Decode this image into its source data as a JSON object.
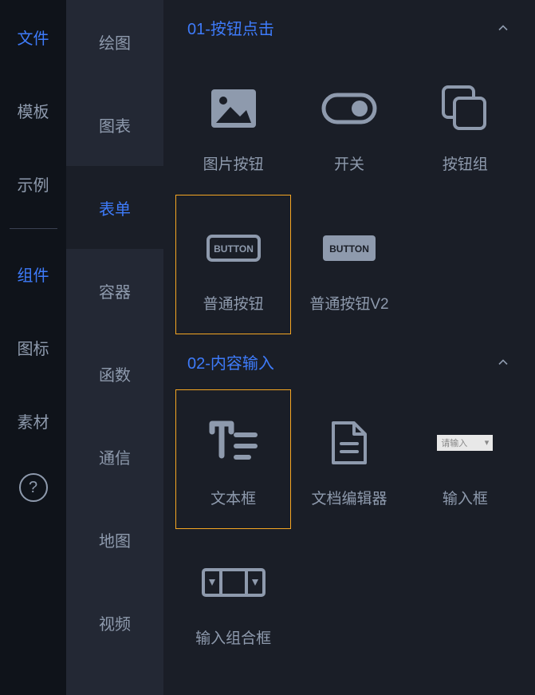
{
  "primary_sidebar": {
    "items": [
      {
        "label": "文件",
        "active": true
      },
      {
        "label": "模板",
        "active": false
      },
      {
        "label": "示例",
        "active": false
      },
      {
        "label": "组件",
        "active": true
      },
      {
        "label": "图标",
        "active": false
      },
      {
        "label": "素材",
        "active": false
      }
    ],
    "help": "?"
  },
  "secondary_sidebar": {
    "items": [
      {
        "label": "绘图",
        "active": false
      },
      {
        "label": "图表",
        "active": false
      },
      {
        "label": "表单",
        "active": true
      },
      {
        "label": "容器",
        "active": false
      },
      {
        "label": "函数",
        "active": false
      },
      {
        "label": "通信",
        "active": false
      },
      {
        "label": "地图",
        "active": false
      },
      {
        "label": "视频",
        "active": false
      }
    ]
  },
  "sections": [
    {
      "title": "01-按钮点击",
      "items": [
        {
          "label": "图片按钮",
          "icon": "image",
          "selected": false
        },
        {
          "label": "开关",
          "icon": "toggle",
          "selected": false
        },
        {
          "label": "按钮组",
          "icon": "button-group",
          "selected": false
        },
        {
          "label": "普通按钮",
          "icon": "button-outline",
          "selected": true
        },
        {
          "label": "普通按钮V2",
          "icon": "button-solid",
          "selected": false
        }
      ]
    },
    {
      "title": "02-内容输入",
      "items": [
        {
          "label": "文本框",
          "icon": "text-box",
          "selected": true
        },
        {
          "label": "文档编辑器",
          "icon": "document",
          "selected": false
        },
        {
          "label": "输入框",
          "icon": "input-field",
          "placeholder": "请输入",
          "selected": false
        },
        {
          "label": "输入组合框",
          "icon": "input-combo",
          "selected": false
        }
      ]
    }
  ]
}
